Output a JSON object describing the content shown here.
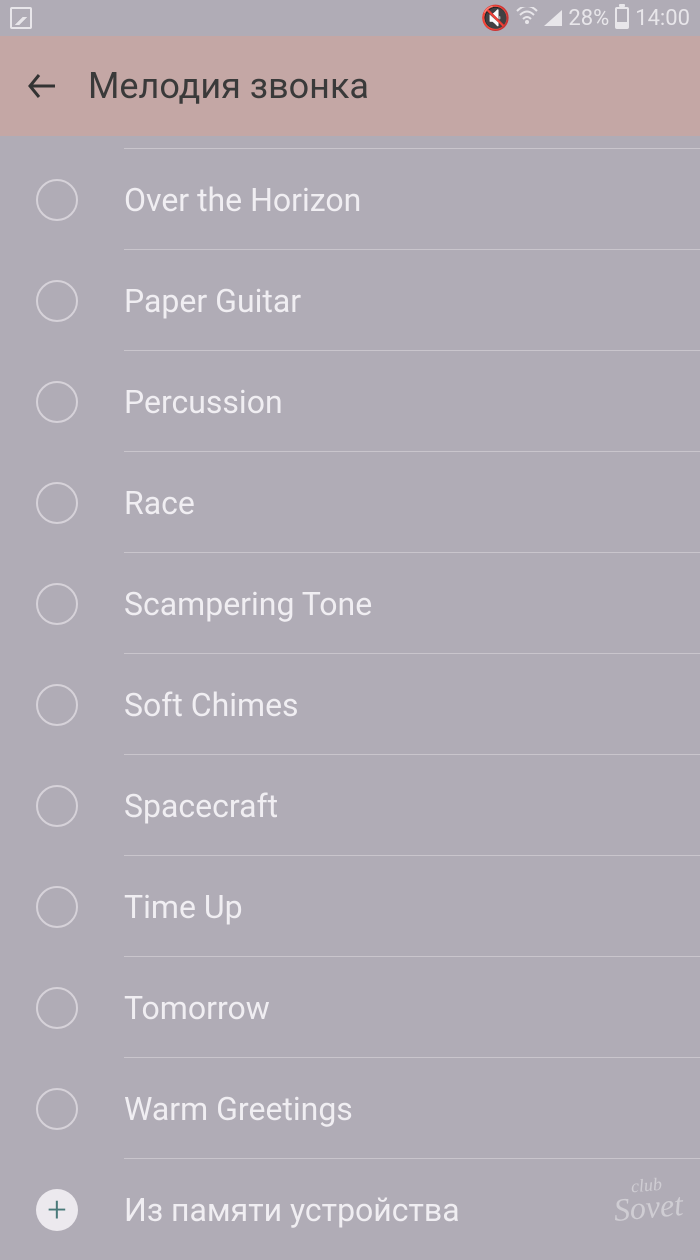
{
  "status": {
    "battery_percent": "28%",
    "time": "14:00"
  },
  "header": {
    "title": "Мелодия звонка"
  },
  "ringtones": [
    "Over the Horizon",
    "Paper Guitar",
    "Percussion",
    "Race",
    "Scampering Tone",
    "Soft Chimes",
    "Spacecraft",
    "Time Up",
    "Tomorrow",
    "Warm Greetings"
  ],
  "add_from_device": "Из памяти устройства",
  "watermark": {
    "top": "club",
    "bottom": "Sovet"
  }
}
